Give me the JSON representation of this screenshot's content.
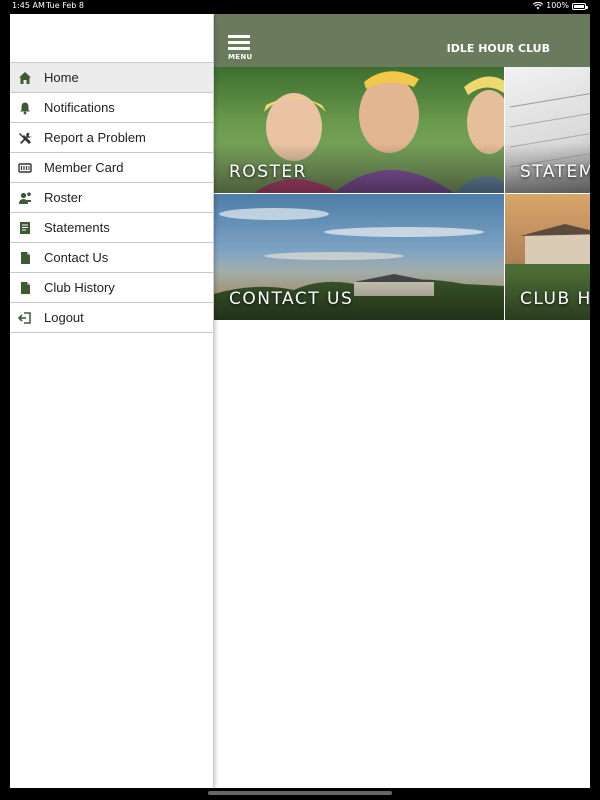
{
  "status_bar": {
    "time": "1:45 AM",
    "date": "Tue Feb 8",
    "battery": "100%"
  },
  "sidebar": {
    "items": [
      {
        "label": "Home",
        "icon": "home-icon",
        "active": true
      },
      {
        "label": "Notifications",
        "icon": "bell-icon",
        "active": false
      },
      {
        "label": "Report a Problem",
        "icon": "tools-icon",
        "active": false
      },
      {
        "label": "Member Card",
        "icon": "card-icon",
        "active": false
      },
      {
        "label": "Roster",
        "icon": "user-group-icon",
        "active": false
      },
      {
        "label": "Statements",
        "icon": "receipt-icon",
        "active": false
      },
      {
        "label": "Contact Us",
        "icon": "document-icon",
        "active": false
      },
      {
        "label": "Club History",
        "icon": "document-icon",
        "active": false
      },
      {
        "label": "Logout",
        "icon": "logout-icon",
        "active": false
      }
    ]
  },
  "header": {
    "menu_label": "MENU",
    "club_name": "IDLE HOUR CLUB"
  },
  "tiles": [
    {
      "label": "ROSTER"
    },
    {
      "label": "STATEMENTS"
    },
    {
      "label": "CONTACT US"
    },
    {
      "label": "CLUB HISTORY"
    }
  ],
  "colors": {
    "header_green": "#6a7b5d",
    "icon_green": "#3e5a35"
  }
}
